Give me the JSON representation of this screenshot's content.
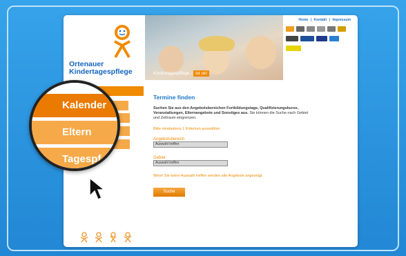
{
  "top_nav": {
    "items": [
      "Home",
      "Kontakt",
      "Impressum"
    ],
    "separator": "|"
  },
  "logo": {
    "line1": "Ortenauer",
    "line2": "Kindertagespflege"
  },
  "hero": {
    "caption_prefix": "Kindertagespflege - ",
    "caption_highlight": "ist ok!"
  },
  "side_menu": {
    "items": [
      "Kalender",
      "Eltern",
      "Tagespf"
    ]
  },
  "content": {
    "title": "Termine finden",
    "intro_bold": "Suchen Sie aus den Angebotsbereichen Fortbildungstage, Qualifizierungskurse, Veranstaltungen, Elternangebote und Sonstiges aus.",
    "intro_rest": " Sie können die Suche nach Gebiet und Zeitraum eingrenzen.",
    "hint": "Bitte mindestens 1 Kriterium auswählen",
    "angebot_label": "Angebotsbereich",
    "angebot_value": "Auswahl treffen",
    "gebiet_label": "Gebiet",
    "gebiet_value": "Auswahl treffen",
    "note": "Wenn Sie keine Auswahl treffen werden alle Angebote angezeigt.",
    "search_button": "Suche"
  },
  "colors": {
    "accent_orange": "#f08a00",
    "title_blue": "#1c78c8",
    "frame_blue": "#2287d4"
  }
}
